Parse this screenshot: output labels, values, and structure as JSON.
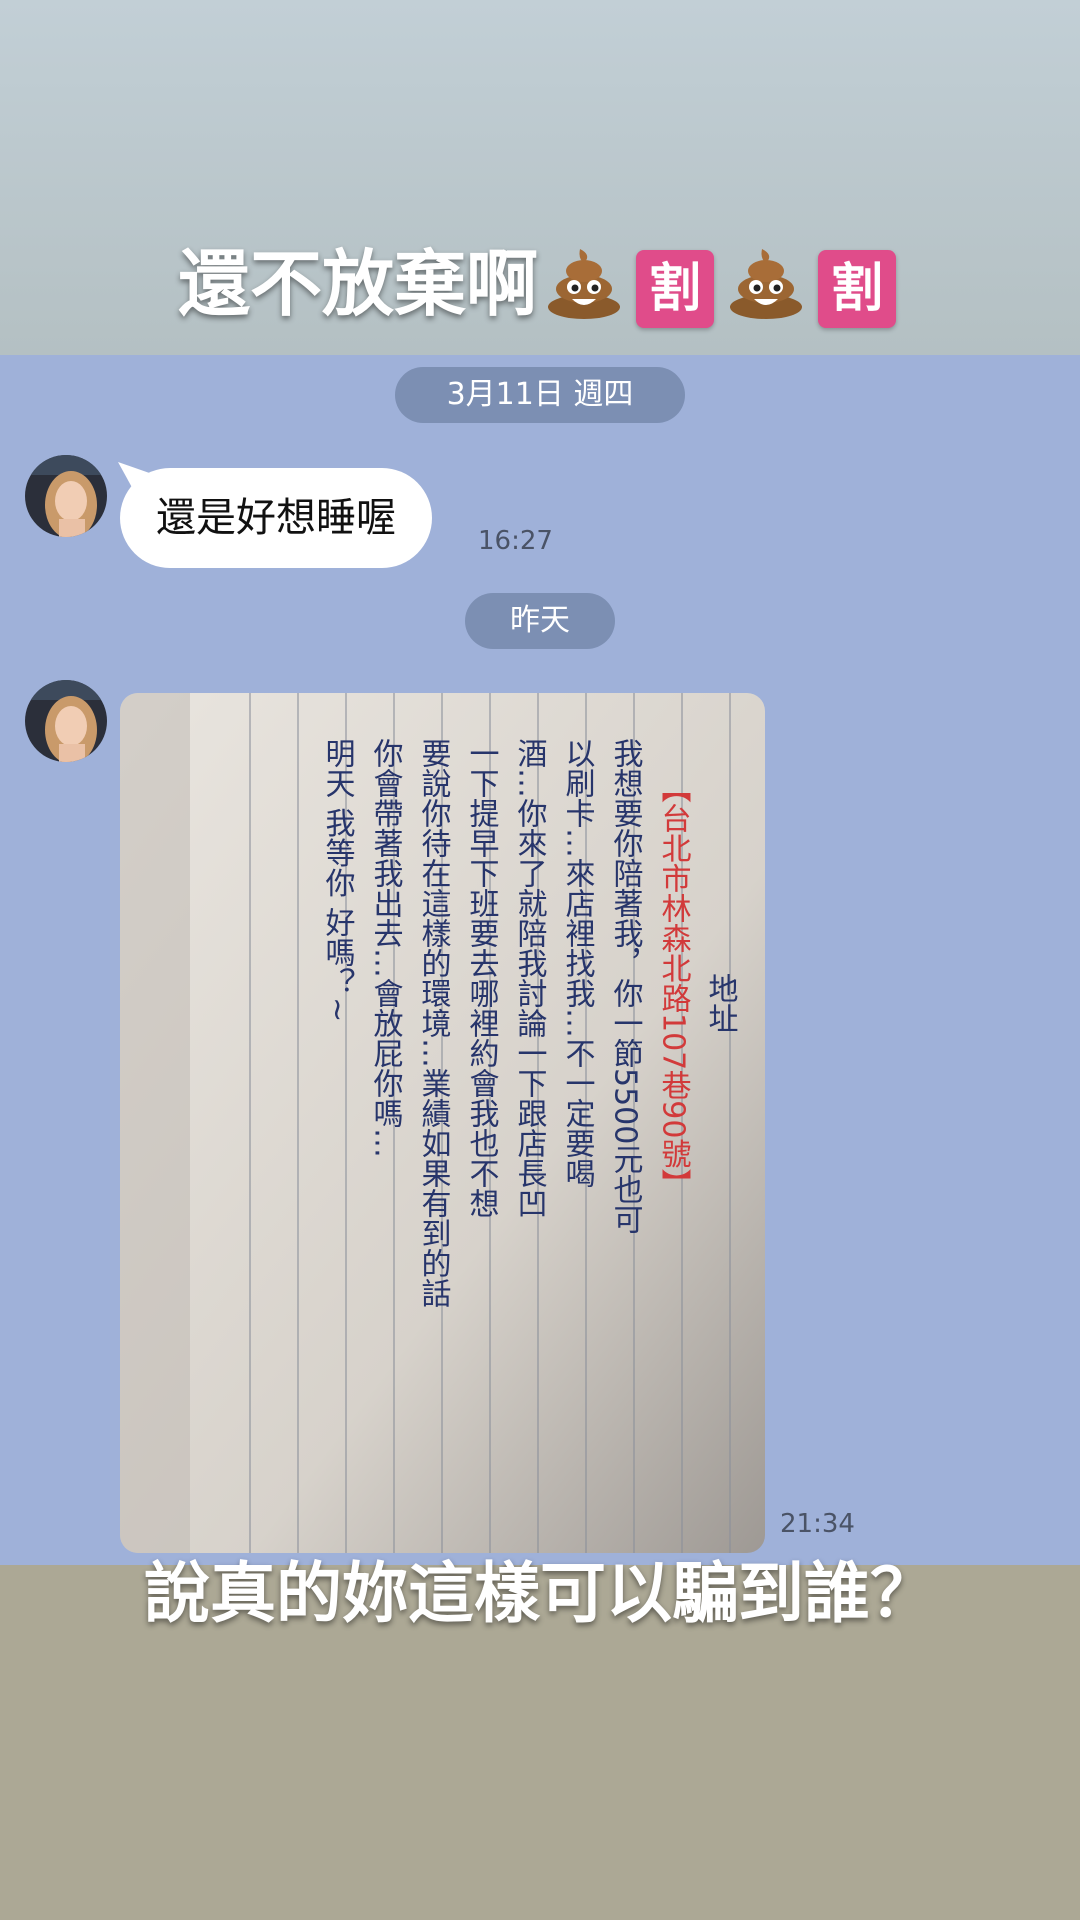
{
  "caption_top": {
    "text": "還不放棄啊",
    "emoji_1": "💩",
    "cut_1": "割",
    "emoji_2": "💩",
    "cut_2": "割"
  },
  "chat": {
    "date_1": "3月11日 週四",
    "message_1": {
      "text": "還是好想睡喔",
      "time": "16:27"
    },
    "date_2": "昨天",
    "message_2": {
      "time": "21:34"
    }
  },
  "note": {
    "title": "地址",
    "lines_red": "【台北市林森北路107巷90號】",
    "lines": [
      "我想要你陪著我，你一節5500元也可",
      "以刷卡…來店裡找我…不一定要喝",
      "酒…你來了就陪我討論一下跟店長凹",
      "一下提早下班要去哪裡約會我也不想",
      "要說你待在這樣的環境…業績如果有到的話",
      "你會帶著我出去…會放屁你嗎…",
      "明天 我等你 好嗎？~"
    ]
  },
  "caption_bottom": {
    "text": "說真的妳這樣可以騙到誰？"
  },
  "colors": {
    "chat_bg": "#9fb1d9",
    "pill": "#7c8fb3",
    "top_band": "#b8c4c8",
    "bottom_band": "#aca895"
  }
}
